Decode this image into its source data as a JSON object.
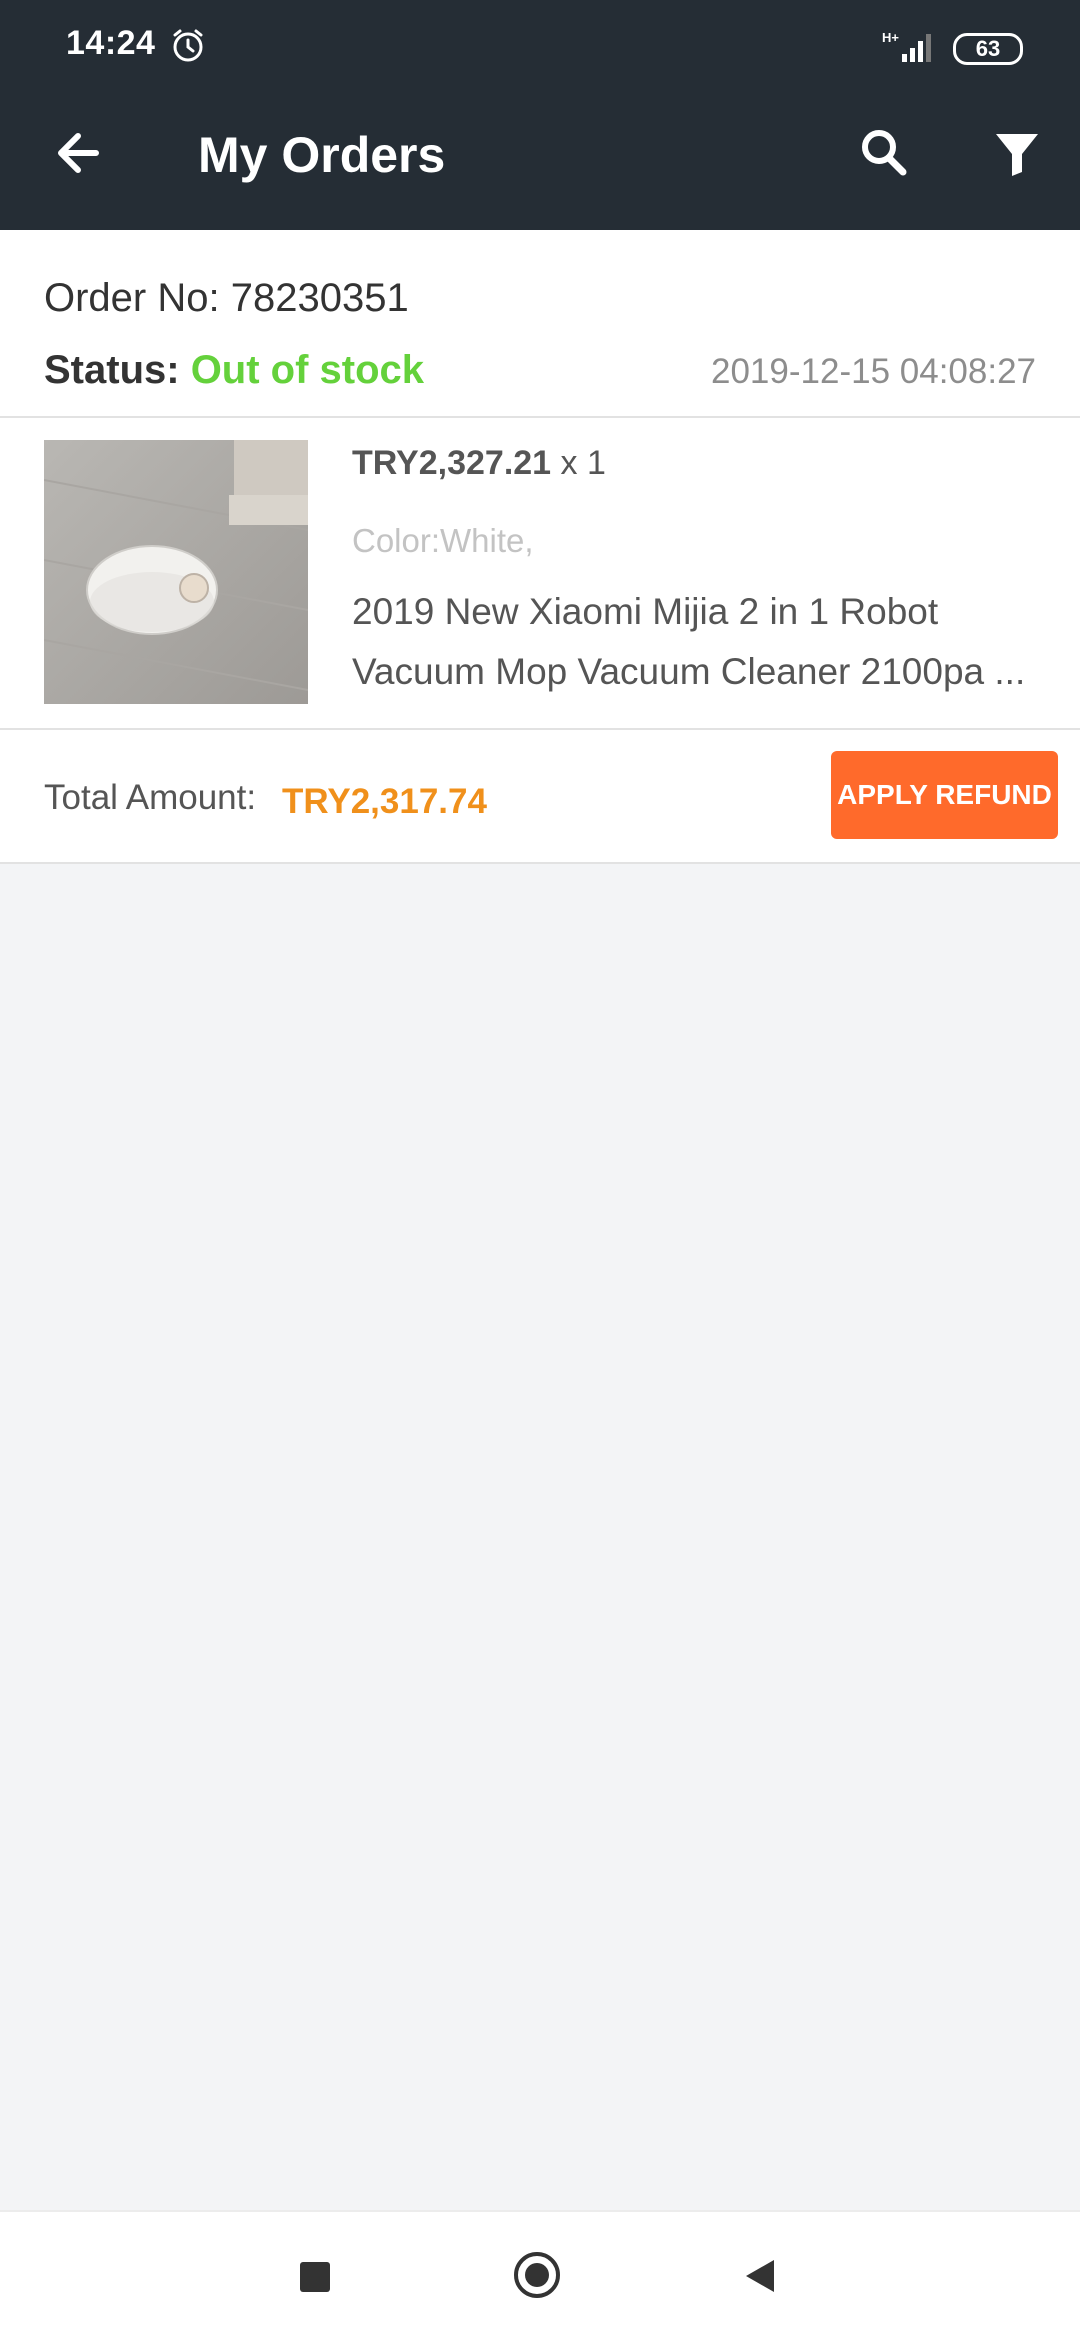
{
  "status_bar": {
    "time": "14:24",
    "network": "H+",
    "battery": "63",
    "icons": [
      "alarm-icon",
      "signal-icon",
      "battery-icon"
    ]
  },
  "app_bar": {
    "title": "My Orders",
    "icons": [
      "back-arrow-icon",
      "search-icon",
      "filter-icon"
    ]
  },
  "order": {
    "order_no": "Order No: 78230351",
    "status_label": "Status: ",
    "status_value": "Out of stock",
    "date": "2019-12-15 04:08:27",
    "item": {
      "price": "TRY2,327.21",
      "qty": " x 1",
      "color": "Color:White,",
      "name": "2019 New Xiaomi Mijia 2 in 1 Robot Vacuum Mop Vacuum Cleaner 2100pa ..."
    },
    "total_label": "Total Amount:",
    "total_value": "TRY2,317.74",
    "refund_label": "APPLY REFUND"
  },
  "colors": {
    "bar_bg": "#252d35",
    "status_green": "#64d13b",
    "total_orange": "#f0901b",
    "button_orange": "#ff6a2b",
    "page_bg": "#f3f4f6"
  },
  "nav_bar": {
    "icons": [
      "recent-apps-icon",
      "home-icon",
      "back-icon"
    ]
  }
}
